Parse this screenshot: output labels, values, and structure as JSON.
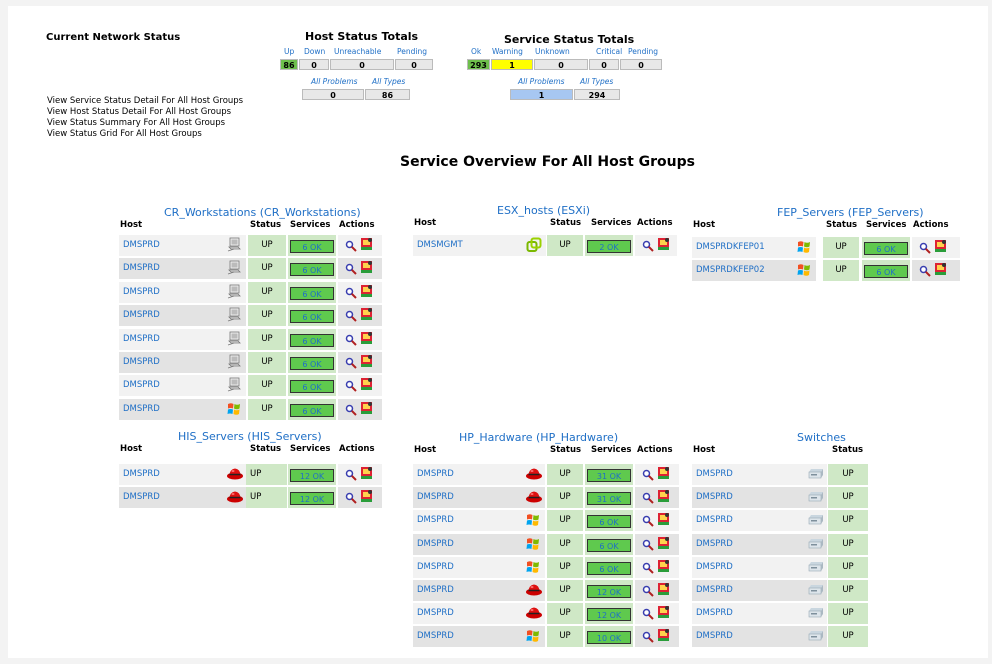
{
  "network_status": {
    "title": "Current Network Status",
    "links": [
      "View Service Status Detail For All Host Groups",
      "View Host Status Detail For All Host Groups",
      "View Status Summary For All Host Groups",
      "View Status Grid For All Host Groups"
    ]
  },
  "host_totals": {
    "title": "Host Status Totals",
    "headers": [
      "Up",
      "Down",
      "Unreachable",
      "Pending"
    ],
    "values": [
      "86",
      "0",
      "0",
      "0"
    ],
    "problems_label": "All Problems",
    "types_label": "All Types",
    "problems_value": "0",
    "types_value": "86"
  },
  "service_totals": {
    "title": "Service Status Totals",
    "headers": [
      "Ok",
      "Warning",
      "Unknown",
      "Critical",
      "Pending"
    ],
    "values": [
      "293",
      "1",
      "0",
      "0",
      "0"
    ],
    "problems_label": "All Problems",
    "types_label": "All Types",
    "problems_value": "1",
    "types_value": "294"
  },
  "overview_title": "Service Overview For All Host Groups",
  "columns": {
    "host": "Host",
    "status": "Status",
    "services": "Services",
    "actions": "Actions"
  },
  "groups": {
    "cr": {
      "title": "CR_Workstations (CR_Workstations)",
      "rows": [
        {
          "host": "DMSPRD",
          "os_icon": "network-computer-icon",
          "status": "UP",
          "services": "6 OK"
        },
        {
          "host": "DMSPRD",
          "os_icon": "network-computer-icon",
          "status": "UP",
          "services": "6 OK"
        },
        {
          "host": "DMSPRD",
          "os_icon": "network-computer-icon",
          "status": "UP",
          "services": "6 OK"
        },
        {
          "host": "DMSPRD",
          "os_icon": "network-computer-icon",
          "status": "UP",
          "services": "6 OK"
        },
        {
          "host": "DMSPRD",
          "os_icon": "network-computer-icon",
          "status": "UP",
          "services": "6 OK"
        },
        {
          "host": "DMSPRD",
          "os_icon": "network-computer-icon",
          "status": "UP",
          "services": "6 OK"
        },
        {
          "host": "DMSPRD",
          "os_icon": "network-computer-icon",
          "status": "UP",
          "services": "6 OK"
        },
        {
          "host": "DMSPRD",
          "os_icon": "windows-logo-icon",
          "status": "UP",
          "services": "6 OK"
        }
      ]
    },
    "esx": {
      "title": "ESX_hosts (ESXi)",
      "rows": [
        {
          "host": "DMSMGMT",
          "os_icon": "vmware-logo-icon",
          "status": "UP",
          "services": "2 OK"
        }
      ]
    },
    "fep": {
      "title": "FEP_Servers (FEP_Servers)",
      "rows": [
        {
          "host": "DMSPRDKFEP01",
          "os_icon": "windows-logo-icon",
          "status": "UP",
          "services": "6 OK"
        },
        {
          "host": "DMSPRDKFEP02",
          "os_icon": "windows-logo-icon",
          "status": "UP",
          "services": "6 OK"
        }
      ]
    },
    "his": {
      "title": "HIS_Servers (HIS_Servers)",
      "rows": [
        {
          "host": "DMSPRD",
          "os_icon": "redhat-logo-icon",
          "status": "UP",
          "services": "12 OK"
        },
        {
          "host": "DMSPRD",
          "os_icon": "redhat-logo-icon",
          "status": "UP",
          "services": "12 OK"
        }
      ]
    },
    "hp": {
      "title": "HP_Hardware (HP_Hardware)",
      "rows": [
        {
          "host": "DMSPRD",
          "os_icon": "redhat-logo-icon",
          "status": "UP",
          "services": "31 OK"
        },
        {
          "host": "DMSPRD",
          "os_icon": "redhat-logo-icon",
          "status": "UP",
          "services": "31 OK"
        },
        {
          "host": "DMSPRD",
          "os_icon": "windows-logo-icon",
          "status": "UP",
          "services": "6 OK"
        },
        {
          "host": "DMSPRD",
          "os_icon": "windows-logo-icon",
          "status": "UP",
          "services": "6 OK"
        },
        {
          "host": "DMSPRD",
          "os_icon": "windows-logo-icon",
          "status": "UP",
          "services": "6 OK"
        },
        {
          "host": "DMSPRD",
          "os_icon": "redhat-logo-icon",
          "status": "UP",
          "services": "12 OK"
        },
        {
          "host": "DMSPRD",
          "os_icon": "redhat-logo-icon",
          "status": "UP",
          "services": "12 OK"
        },
        {
          "host": "DMSPRD",
          "os_icon": "windows-logo-icon",
          "status": "UP",
          "services": "10 OK"
        }
      ]
    },
    "sw": {
      "title": "Switches",
      "rows": [
        {
          "host": "DMSPRD",
          "os_icon": "switch-icon",
          "status": "UP"
        },
        {
          "host": "DMSPRD",
          "os_icon": "switch-icon",
          "status": "UP"
        },
        {
          "host": "DMSPRD",
          "os_icon": "switch-icon",
          "status": "UP"
        },
        {
          "host": "DMSPRD",
          "os_icon": "switch-icon",
          "status": "UP"
        },
        {
          "host": "DMSPRD",
          "os_icon": "switch-icon",
          "status": "UP"
        },
        {
          "host": "DMSPRD",
          "os_icon": "switch-icon",
          "status": "UP"
        },
        {
          "host": "DMSPRD",
          "os_icon": "switch-icon",
          "status": "UP"
        },
        {
          "host": "DMSPRD",
          "os_icon": "switch-icon",
          "status": "UP"
        }
      ]
    }
  }
}
